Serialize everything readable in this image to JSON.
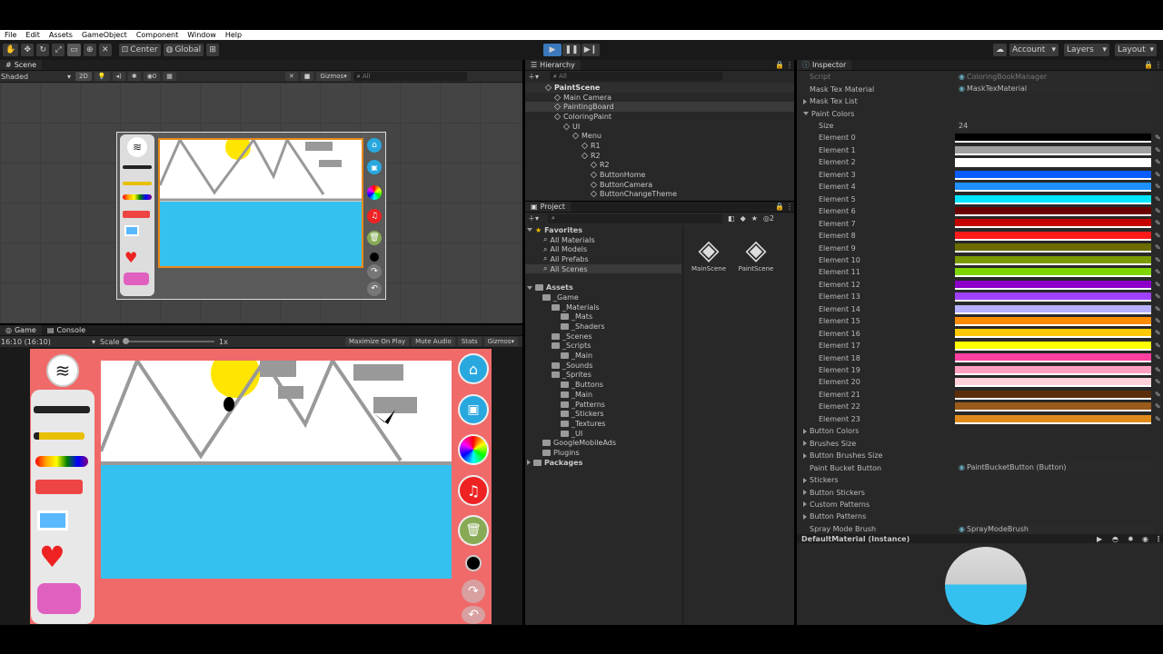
{
  "menu": {
    "items": [
      "File",
      "Edit",
      "Assets",
      "GameObject",
      "Component",
      "Window",
      "Help"
    ]
  },
  "toolbar": {
    "center": "Center",
    "global": "Global",
    "account": "Account",
    "layers": "Layers",
    "layout": "Layout"
  },
  "scene": {
    "tab": "Scene",
    "shading": "Shaded",
    "mode2d": "2D",
    "gizmos": "Gizmos",
    "search_placeholder": "All",
    "layers_count": "0"
  },
  "game": {
    "tab": "Game",
    "console_tab": "Console",
    "aspect": "16:10 (16:10)",
    "scale_label": "Scale",
    "scale_value": "1x",
    "maximize": "Maximize On Play",
    "mute": "Mute Audio",
    "stats": "Stats",
    "gizmos": "Gizmos"
  },
  "hierarchy": {
    "tab": "Hierarchy",
    "search_placeholder": "All",
    "items": [
      {
        "label": "PaintScene",
        "indent": 0,
        "type": "scene"
      },
      {
        "label": "Main Camera",
        "indent": 1,
        "type": "object"
      },
      {
        "label": "PaintingBoard",
        "indent": 1,
        "type": "object"
      },
      {
        "label": "ColoringPaint",
        "indent": 1,
        "type": "object"
      },
      {
        "label": "UI",
        "indent": 2,
        "type": "object"
      },
      {
        "label": "Menu",
        "indent": 3,
        "type": "object"
      },
      {
        "label": "R1",
        "indent": 4,
        "type": "object"
      },
      {
        "label": "R2",
        "indent": 4,
        "type": "object"
      },
      {
        "label": "R2",
        "indent": 5,
        "type": "object"
      },
      {
        "label": "ButtonHome",
        "indent": 5,
        "type": "object"
      },
      {
        "label": "ButtonCamera",
        "indent": 5,
        "type": "object"
      },
      {
        "label": "ButtonChangeTheme",
        "indent": 5,
        "type": "object"
      }
    ]
  },
  "project": {
    "tab": "Project",
    "count": "2",
    "favorites_label": "Favorites",
    "favorites": [
      "All Materials",
      "All Models",
      "All Prefabs",
      "All Scenes"
    ],
    "assets_label": "Assets",
    "tree": [
      {
        "label": "_Game",
        "indent": 1
      },
      {
        "label": "_Materials",
        "indent": 2
      },
      {
        "label": "_Mats",
        "indent": 3
      },
      {
        "label": "_Shaders",
        "indent": 3
      },
      {
        "label": "_Scenes",
        "indent": 2
      },
      {
        "label": "_Scripts",
        "indent": 2
      },
      {
        "label": "_Main",
        "indent": 3
      },
      {
        "label": "_Sounds",
        "indent": 2
      },
      {
        "label": "_Sprites",
        "indent": 2
      },
      {
        "label": "_Buttons",
        "indent": 3
      },
      {
        "label": "_Main",
        "indent": 3
      },
      {
        "label": "_Patterns",
        "indent": 3
      },
      {
        "label": "_Stickers",
        "indent": 3
      },
      {
        "label": "_Textures",
        "indent": 3
      },
      {
        "label": "_UI",
        "indent": 3
      },
      {
        "label": "GoogleMobileAds",
        "indent": 1
      },
      {
        "label": "Plugins",
        "indent": 1
      }
    ],
    "packages_label": "Packages",
    "assets": [
      "MainScene",
      "PaintScene"
    ]
  },
  "inspector": {
    "tab": "Inspector",
    "script_label": "Script",
    "script_value": "ColoringBookManager",
    "mask_tex_material_label": "Mask Tex Material",
    "mask_tex_material_value": "MaskTexMaterial",
    "mask_tex_list_label": "Mask Tex List",
    "paint_colors_label": "Paint Colors",
    "size_label": "Size",
    "size_value": "24",
    "elements": [
      "Element 0",
      "Element 1",
      "Element 2",
      "Element 3",
      "Element 4",
      "Element 5",
      "Element 6",
      "Element 7",
      "Element 8",
      "Element 9",
      "Element 10",
      "Element 11",
      "Element 12",
      "Element 13",
      "Element 14",
      "Element 15",
      "Element 16",
      "Element 17",
      "Element 18",
      "Element 19",
      "Element 20",
      "Element 21",
      "Element 22",
      "Element 23"
    ],
    "colors": [
      "#000000",
      "#a0a0a0",
      "#ffffff",
      "#0a5cff",
      "#1e90ff",
      "#00e5ff",
      "#6b0000",
      "#c40000",
      "#ff1a1a",
      "#6b6b00",
      "#7a9a00",
      "#7fd400",
      "#8c00c8",
      "#a040ff",
      "#b5b0ff",
      "#ff8c00",
      "#ffc800",
      "#ffff00",
      "#ff3fa0",
      "#ff9fc0",
      "#ffd0d8",
      "#5a2e0a",
      "#9a5a1a",
      "#e08a1a"
    ],
    "sections": [
      "Button Colors",
      "Brushes Size",
      "Button Brushes Size",
      "Paint Bucket Button",
      "Stickers",
      "Button Stickers",
      "Custom Patterns",
      "Button Patterns",
      "Spray Mode Brush"
    ],
    "paint_bucket_value": "PaintBucketButton (Button)",
    "spray_value": "SprayModeBrush",
    "material_label": "DefaultMaterial (Instance)"
  },
  "colors": {
    "accent": "#3a79bb",
    "panel": "#282828",
    "game_bg": "#f06a6a",
    "water": "#35c1ef",
    "sun": "#ffe600"
  }
}
